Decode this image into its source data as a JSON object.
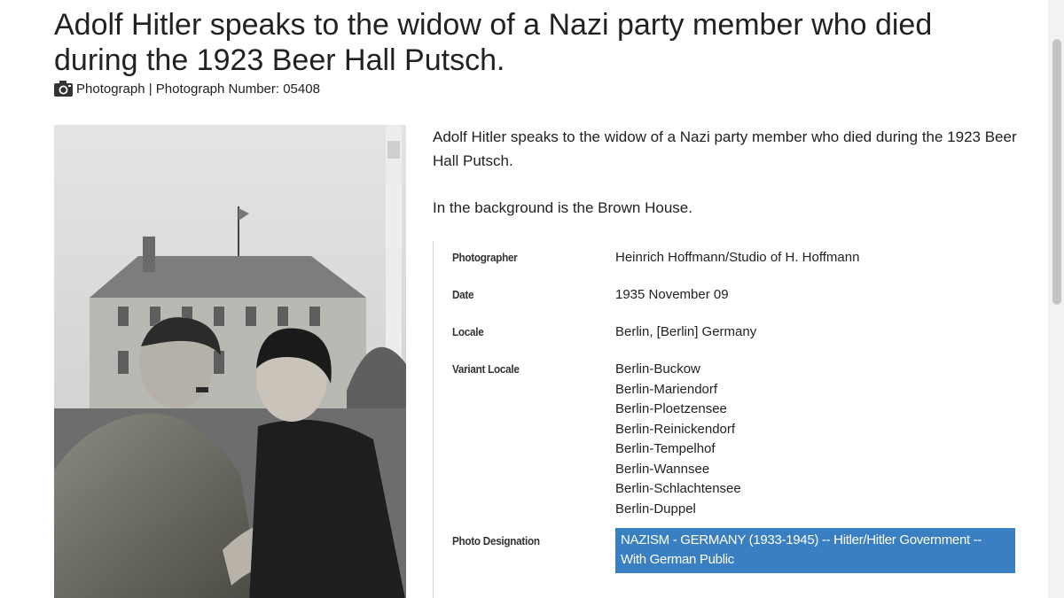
{
  "record": {
    "title": "Adolf Hitler speaks to the widow of a Nazi party member who died during the 1923 Beer Hall Putsch.",
    "meta": {
      "icon": "camera-icon",
      "text": "Photograph | Photograph Number: 05408"
    },
    "photo": {
      "alt": "Adolf Hitler speaks to the widow of a Nazi party member who died during the 1923 Beer Hall Putsch."
    },
    "caption": {
      "paragraph_1": "Adolf Hitler speaks to the widow of a Nazi party member who died during the 1923 Beer Hall Putsch.",
      "paragraph_2": "In the background is the Brown House."
    },
    "details": {
      "photographer": {
        "label": "Photographer",
        "value": "Heinrich Hoffmann/Studio of H. Hoffmann"
      },
      "date": {
        "label": "Date",
        "value": "1935 November 09"
      },
      "locale": {
        "label": "Locale",
        "value": "Berlin, [Berlin] Germany"
      },
      "variant_locale": {
        "label": "Variant Locale",
        "values": [
          "Berlin-Buckow",
          "Berlin-Mariendorf",
          "Berlin-Ploetzensee",
          "Berlin-Reinickendorf",
          "Berlin-Tempelhof",
          "Berlin-Wannsee",
          "Berlin-Schlachtensee",
          "Berlin-Duppel"
        ]
      },
      "photo_designation": {
        "label": "Photo Designation",
        "value": "NAZISM - GERMANY (1933-1945) -- Hitler/Hitler Government -- With German Public",
        "color": "#3a7fc1"
      }
    }
  }
}
